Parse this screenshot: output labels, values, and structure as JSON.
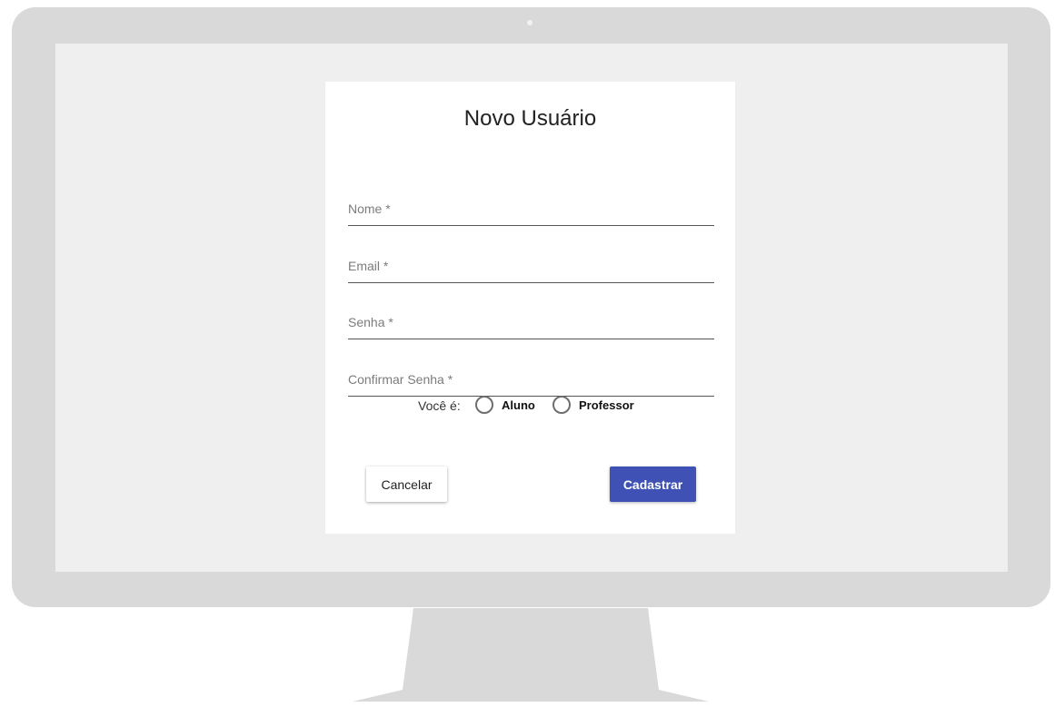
{
  "form": {
    "title": "Novo Usuário",
    "fields": {
      "name_placeholder": "Nome *",
      "email_placeholder": "Email *",
      "password_placeholder": "Senha *",
      "confirm_password_placeholder": "Confirmar Senha *"
    },
    "role": {
      "label": "Você é:",
      "options": [
        "Aluno",
        "Professor"
      ]
    },
    "buttons": {
      "cancel": "Cancelar",
      "submit": "Cadastrar"
    }
  },
  "colors": {
    "primary": "#3f51b5",
    "monitor_frame": "#d9d9d9",
    "screen_background": "#efefef"
  }
}
